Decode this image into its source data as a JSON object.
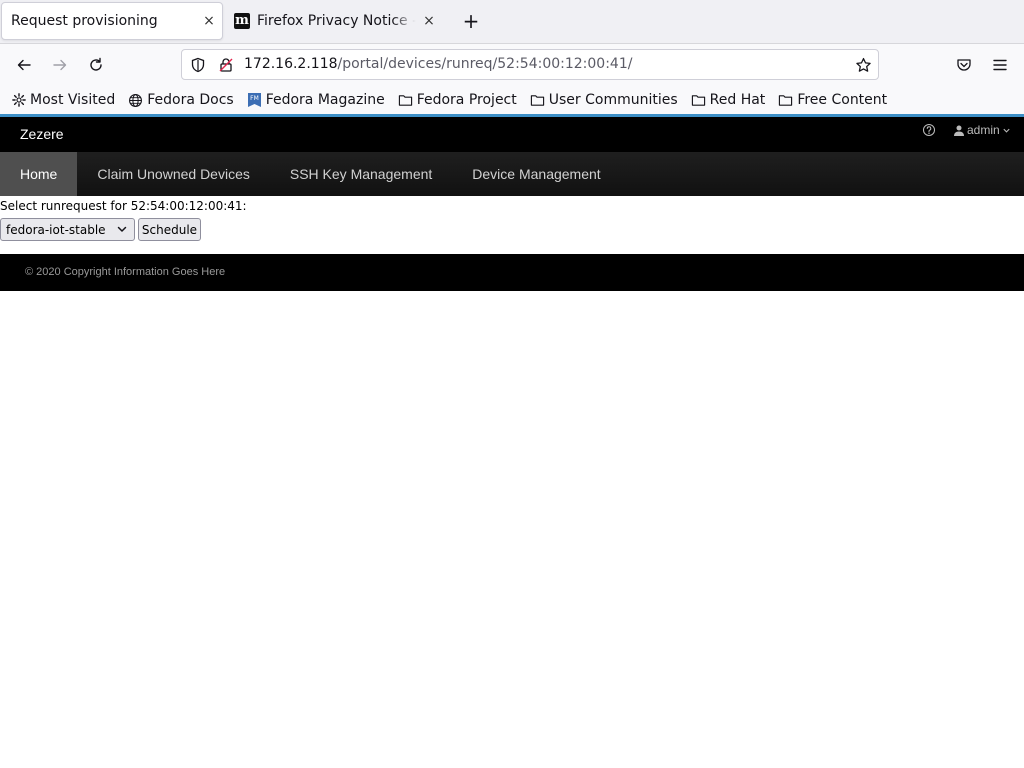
{
  "browser": {
    "tabs": [
      {
        "label": "Request provisioning",
        "close": "×"
      },
      {
        "label": "Firefox Privacy Notice — Mozilla",
        "favicon": "m",
        "close": "×"
      }
    ],
    "new_tab": "+",
    "url": {
      "host": "172.16.2.118",
      "path": "/portal/devices/runreq/52:54:00:12:00:41/"
    },
    "bookmarks": [
      {
        "label": "Most Visited",
        "icon": "gear-icon"
      },
      {
        "label": "Fedora Docs",
        "icon": "globe-icon"
      },
      {
        "label": "Fedora Magazine",
        "icon": "fedora-magazine-icon"
      },
      {
        "label": "Fedora Project",
        "icon": "folder-icon"
      },
      {
        "label": "User Communities",
        "icon": "folder-icon"
      },
      {
        "label": "Red Hat",
        "icon": "folder-icon"
      },
      {
        "label": "Free Content",
        "icon": "folder-icon"
      }
    ]
  },
  "app": {
    "brand": "Zezere",
    "user": "admin",
    "nav": [
      {
        "label": "Home",
        "active": true
      },
      {
        "label": "Claim Unowned Devices",
        "active": false
      },
      {
        "label": "SSH Key Management",
        "active": false
      },
      {
        "label": "Device Management",
        "active": false
      }
    ],
    "form": {
      "prompt": "Select runrequest for 52:54:00:12:00:41:",
      "selected": "fedora-iot-stable",
      "button": "Schedule"
    },
    "footer": "© 2020 Copyright Information Goes Here"
  },
  "colors": {
    "accent": "#3d8fc6",
    "header": "#000000",
    "nav_active": "#4f4f4f"
  }
}
